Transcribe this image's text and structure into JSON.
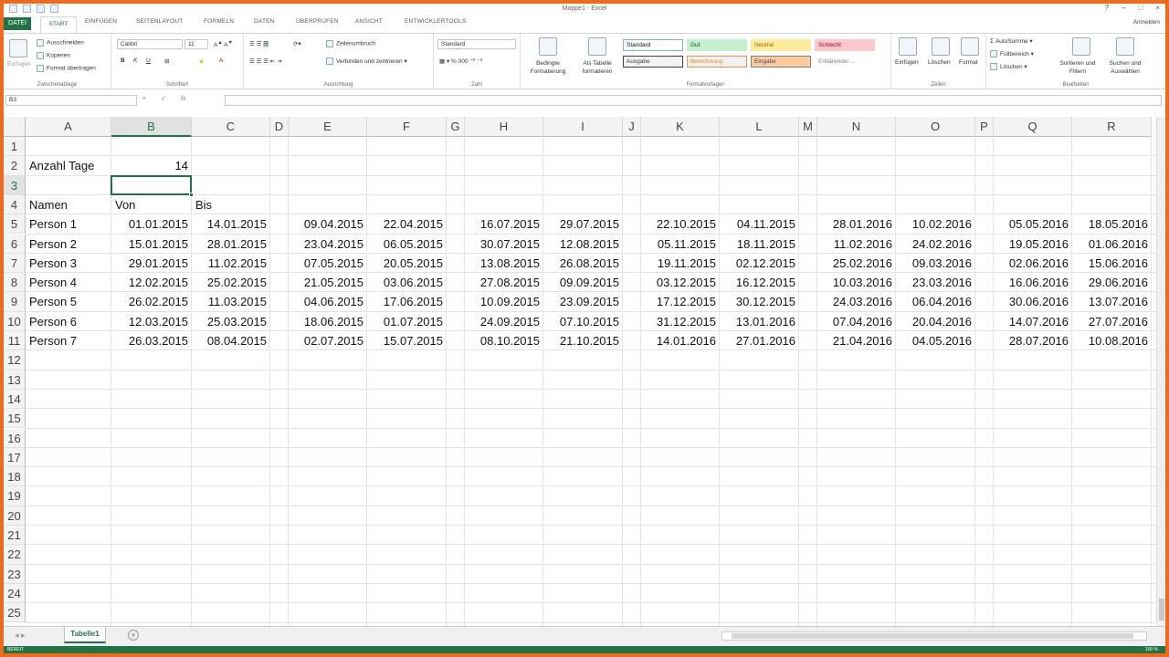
{
  "window": {
    "title": "Mappe1 - Excel",
    "user": "Anmelden"
  },
  "ribbon_tabs": {
    "file": "DATEI",
    "start": "START",
    "insert": "EINFÜGEN",
    "layout": "SEITENLAYOUT",
    "formulas": "FORMELN",
    "data": "DATEN",
    "review": "ÜBERPRÜFEN",
    "view": "ANSICHT",
    "developer": "ENTWICKLERTOOLS"
  },
  "clipboard": {
    "paste": "Einfügen",
    "cut": "Ausschneiden",
    "copy": "Kopieren",
    "format_painter": "Format übertragen",
    "label": "Zwischenablage"
  },
  "font": {
    "name": "Calibri",
    "size": "11",
    "label": "Schriftart"
  },
  "alignment": {
    "wrap": "Zeilenumbruch",
    "merge": "Verbinden und zentrieren",
    "label": "Ausrichtung"
  },
  "number": {
    "format": "Standard",
    "label": "Zahl"
  },
  "styles": {
    "conditional": "Bedingte Formatierung",
    "as_table": "Als Tabelle formatieren",
    "cells": [
      {
        "name": "Standard",
        "bg": "#ffffff",
        "border": "#7fb0c8",
        "color": "#111111"
      },
      {
        "name": "Gut",
        "bg": "#c6efce",
        "border": "#c6efce",
        "color": "#006100"
      },
      {
        "name": "Neutral",
        "bg": "#ffeb9c",
        "border": "#ffeb9c",
        "color": "#9c6500"
      },
      {
        "name": "Schlecht",
        "bg": "#ffc7ce",
        "border": "#ffc7ce",
        "color": "#9c0006"
      },
      {
        "name": "Ausgabe",
        "bg": "#f2f2f2",
        "border": "#3f3f3f",
        "color": "#3f3f3f"
      },
      {
        "name": "Berechnung",
        "bg": "#f2f2f2",
        "border": "#f09050",
        "color": "#fa7d00"
      },
      {
        "name": "Eingabe",
        "bg": "#ffcc99",
        "border": "#7f7f7f",
        "color": "#3f3f76"
      },
      {
        "name": "Erklärender ...",
        "bg": "#ffffff",
        "border": "#ffffff",
        "color": "#7f7f7f"
      }
    ],
    "label": "Formatvorlagen"
  },
  "cells_group": {
    "insert": "Einfügen",
    "delete": "Löschen",
    "format": "Format",
    "label": "Zellen"
  },
  "editing": {
    "autosum": "AutoSumme",
    "fill": "Füllbereich",
    "clear": "Löschen",
    "sort": "Sortieren und Filtern",
    "find": "Suchen und Auswählen",
    "label": "Bearbeiten"
  },
  "formula_bar": {
    "name_box": "B3",
    "cancel": "×",
    "enter": "✓",
    "fx": "fx",
    "content": ""
  },
  "grid": {
    "columns": [
      "A",
      "B",
      "C",
      "D",
      "E",
      "F",
      "G",
      "H",
      "I",
      "J",
      "K",
      "L",
      "M",
      "N",
      "O",
      "P",
      "Q",
      "R"
    ],
    "rows": [
      "1",
      "2",
      "3",
      "4",
      "5",
      "6",
      "7",
      "8",
      "9",
      "10",
      "11",
      "12",
      "13",
      "14",
      "15",
      "16",
      "17",
      "18",
      "19",
      "20",
      "21",
      "22",
      "23",
      "24",
      "25"
    ],
    "label_anzahl": "Anzahl Tage",
    "value_anzahl": "14",
    "hdr_namen": "Namen",
    "hdr_von": "Von",
    "hdr_bis": "Bis",
    "persons": [
      "Person 1",
      "Person 2",
      "Person 3",
      "Person 4",
      "Person 5",
      "Person 6",
      "Person 7"
    ],
    "data": [
      [
        "01.01.2015",
        "14.01.2015",
        "09.04.2015",
        "22.04.2015",
        "16.07.2015",
        "29.07.2015",
        "22.10.2015",
        "04.11.2015",
        "28.01.2016",
        "10.02.2016",
        "05.05.2016",
        "18.05.2016"
      ],
      [
        "15.01.2015",
        "28.01.2015",
        "23.04.2015",
        "06.05.2015",
        "30.07.2015",
        "12.08.2015",
        "05.11.2015",
        "18.11.2015",
        "11.02.2016",
        "24.02.2016",
        "19.05.2016",
        "01.06.2016"
      ],
      [
        "29.01.2015",
        "11.02.2015",
        "07.05.2015",
        "20.05.2015",
        "13.08.2015",
        "26.08.2015",
        "19.11.2015",
        "02.12.2015",
        "25.02.2016",
        "09.03.2016",
        "02.06.2016",
        "15.06.2016"
      ],
      [
        "12.02.2015",
        "25.02.2015",
        "21.05.2015",
        "03.06.2015",
        "27.08.2015",
        "09.09.2015",
        "03.12.2015",
        "16.12.2015",
        "10.03.2016",
        "23.03.2016",
        "16.06.2016",
        "29.06.2016"
      ],
      [
        "26.02.2015",
        "11.03.2015",
        "04.06.2015",
        "17.06.2015",
        "10.09.2015",
        "23.09.2015",
        "17.12.2015",
        "30.12.2015",
        "24.03.2016",
        "06.04.2016",
        "30.06.2016",
        "13.07.2016"
      ],
      [
        "12.03.2015",
        "25.03.2015",
        "18.06.2015",
        "01.07.2015",
        "24.09.2015",
        "07.10.2015",
        "31.12.2015",
        "13.01.2016",
        "07.04.2016",
        "20.04.2016",
        "14.07.2016",
        "27.07.2016"
      ],
      [
        "26.03.2015",
        "08.04.2015",
        "02.07.2015",
        "15.07.2015",
        "08.10.2015",
        "21.10.2015",
        "14.01.2016",
        "27.01.2016",
        "21.04.2016",
        "04.05.2016",
        "28.07.2016",
        "10.08.2016"
      ]
    ]
  },
  "sheet_tabs": {
    "active": "Tabelle1",
    "add": "+"
  },
  "status": {
    "ready": "BEREIT",
    "zoom": "100 %"
  }
}
